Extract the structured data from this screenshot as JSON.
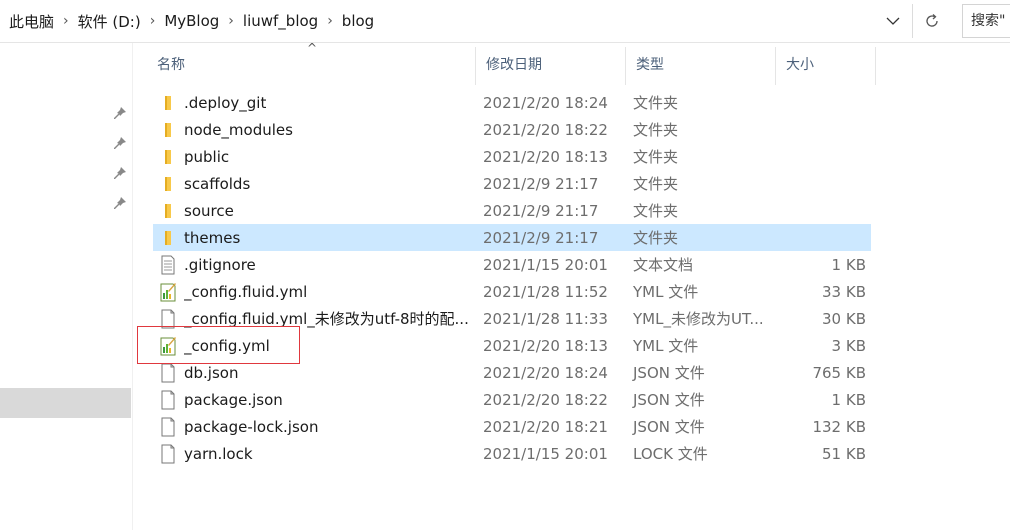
{
  "address": {
    "crumbs": [
      "此电脑",
      "软件 (D:)",
      "MyBlog",
      "liuwf_blog",
      "blog"
    ],
    "search_placeholder": "搜索\""
  },
  "columns": {
    "name": "名称",
    "date": "修改日期",
    "type": "类型",
    "size": "大小"
  },
  "files": [
    {
      "name": ".deploy_git",
      "date": "2021/2/20 18:24",
      "type": "文件夹",
      "size": "",
      "icon": "folder-icon"
    },
    {
      "name": "node_modules",
      "date": "2021/2/20 18:22",
      "type": "文件夹",
      "size": "",
      "icon": "folder-icon"
    },
    {
      "name": "public",
      "date": "2021/2/20 18:13",
      "type": "文件夹",
      "size": "",
      "icon": "folder-icon"
    },
    {
      "name": "scaffolds",
      "date": "2021/2/9 21:17",
      "type": "文件夹",
      "size": "",
      "icon": "folder-icon"
    },
    {
      "name": "source",
      "date": "2021/2/9 21:17",
      "type": "文件夹",
      "size": "",
      "icon": "folder-icon"
    },
    {
      "name": "themes",
      "date": "2021/2/9 21:17",
      "type": "文件夹",
      "size": "",
      "icon": "folder-icon",
      "selected": true
    },
    {
      "name": ".gitignore",
      "date": "2021/1/15 20:01",
      "type": "文本文档",
      "size": "1 KB",
      "icon": "text-file-icon"
    },
    {
      "name": "_config.fluid.yml",
      "date": "2021/1/28 11:52",
      "type": "YML 文件",
      "size": "33 KB",
      "icon": "yml-file-icon"
    },
    {
      "name": "_config.fluid.yml_未修改为utf-8时的配...",
      "date": "2021/1/28 11:33",
      "type": "YML_未修改为UT...",
      "size": "30 KB",
      "icon": "blank-file-icon"
    },
    {
      "name": "_config.yml",
      "date": "2021/2/20 18:13",
      "type": "YML 文件",
      "size": "3 KB",
      "icon": "yml-file-icon"
    },
    {
      "name": "db.json",
      "date": "2021/2/20 18:24",
      "type": "JSON 文件",
      "size": "765 KB",
      "icon": "blank-file-icon"
    },
    {
      "name": "package.json",
      "date": "2021/2/20 18:22",
      "type": "JSON 文件",
      "size": "1 KB",
      "icon": "blank-file-icon"
    },
    {
      "name": "package-lock.json",
      "date": "2021/2/20 18:21",
      "type": "JSON 文件",
      "size": "132 KB",
      "icon": "blank-file-icon"
    },
    {
      "name": "yarn.lock",
      "date": "2021/1/15 20:01",
      "type": "LOCK 文件",
      "size": "51 KB",
      "icon": "blank-file-icon"
    }
  ],
  "colors": {
    "selection": "#cce8ff",
    "highlight_border": "#e0383e",
    "folder": "#f8c94a",
    "header_text": "#4c607a"
  }
}
